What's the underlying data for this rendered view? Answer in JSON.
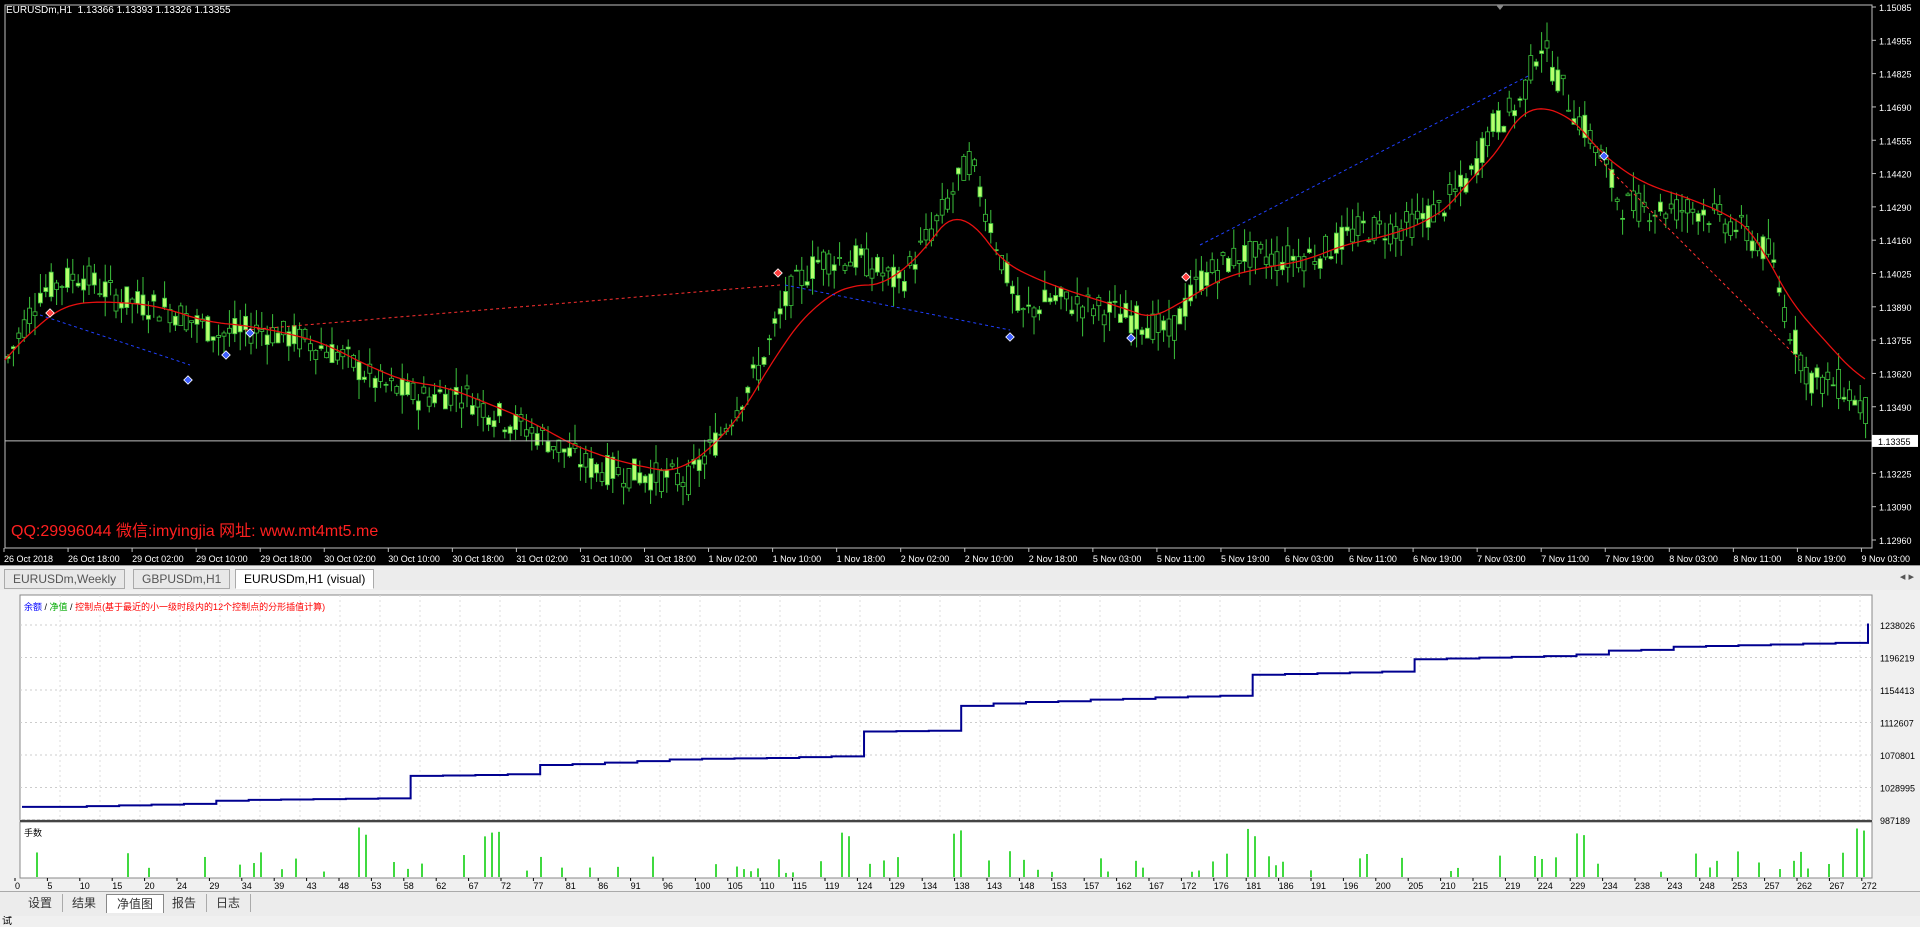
{
  "chart": {
    "symbol_header": "EURUSDm,H1  1.13366 1.13393 1.13326 1.13355",
    "watermark": "QQ:29996044 微信:imyingjia 网址: www.mt4mt5.me",
    "current_price": "1.13355",
    "price_labels": [
      "1.15085",
      "1.14955",
      "1.14825",
      "1.14690",
      "1.14555",
      "1.14420",
      "1.14290",
      "1.14160",
      "1.14025",
      "1.13890",
      "1.13755",
      "1.13620",
      "1.13490",
      "1.13355",
      "1.13225",
      "1.13090",
      "1.12960"
    ],
    "time_labels": [
      "26 Oct 2018",
      "26 Oct 18:00",
      "29 Oct 02:00",
      "29 Oct 10:00",
      "29 Oct 18:00",
      "30 Oct 02:00",
      "30 Oct 10:00",
      "30 Oct 18:00",
      "31 Oct 02:00",
      "31 Oct 10:00",
      "31 Oct 18:00",
      "1 Nov 02:00",
      "1 Nov 10:00",
      "1 Nov 18:00",
      "2 Nov 02:00",
      "2 Nov 10:00",
      "2 Nov 18:00",
      "5 Nov 03:00",
      "5 Nov 11:00",
      "5 Nov 19:00",
      "6 Nov 03:00",
      "6 Nov 11:00",
      "6 Nov 19:00",
      "7 Nov 03:00",
      "7 Nov 11:00",
      "7 Nov 19:00",
      "8 Nov 03:00",
      "8 Nov 11:00",
      "8 Nov 19:00",
      "9 Nov 03:00"
    ],
    "colors": {
      "bull": "#b6ff6e",
      "bear": "#000000",
      "wick": "#3cc43c",
      "ma": "#e81010",
      "zigzag_red": "#ff3030",
      "zigzag_blue": "#2040ff"
    }
  },
  "chart_tabs": [
    {
      "label": "EURUSDm,Weekly",
      "active": false
    },
    {
      "label": "GBPUSDm,H1",
      "active": false
    },
    {
      "label": "EURUSDm,H1 (visual)",
      "active": true
    }
  ],
  "equity": {
    "legend_balance": "余额",
    "legend_sep1": " / ",
    "legend_equity": "净值",
    "legend_sep2": " / ",
    "legend_points": "控制点(基于最近的小一级时段内的12个控制点的分形插值计算)",
    "y_labels": [
      "1238026",
      "1196219",
      "1154413",
      "1112607",
      "1070801",
      "1028995",
      "987189"
    ],
    "lots_label": "手数",
    "x_labels": [
      "0",
      "5",
      "10",
      "15",
      "20",
      "24",
      "29",
      "34",
      "39",
      "43",
      "48",
      "53",
      "58",
      "62",
      "67",
      "72",
      "77",
      "81",
      "86",
      "91",
      "96",
      "100",
      "105",
      "110",
      "115",
      "119",
      "124",
      "129",
      "134",
      "138",
      "143",
      "148",
      "153",
      "157",
      "162",
      "167",
      "172",
      "176",
      "181",
      "186",
      "191",
      "196",
      "200",
      "205",
      "210",
      "215",
      "219",
      "224",
      "229",
      "234",
      "238",
      "243",
      "248",
      "253",
      "257",
      "262",
      "267",
      "272"
    ],
    "balance_values": [
      1004000,
      1004000,
      1005000,
      1006000,
      1007000,
      1008000,
      1012000,
      1013000,
      1013500,
      1014000,
      1014500,
      1015000,
      1044000,
      1044500,
      1045000,
      1046000,
      1058000,
      1059000,
      1061000,
      1063000,
      1065000,
      1066000,
      1066500,
      1067000,
      1068000,
      1069000,
      1101000,
      1101500,
      1102000,
      1134000,
      1137000,
      1139000,
      1140000,
      1142000,
      1143000,
      1145000,
      1146000,
      1147000,
      1174000,
      1175000,
      1176000,
      1177000,
      1178000,
      1194000,
      1195000,
      1196000,
      1197000,
      1198000,
      1200000,
      1205000,
      1206000,
      1210000,
      1211000,
      1212000,
      1213000,
      1214000,
      1215000,
      1240000
    ],
    "colors": {
      "balance": "#000090",
      "legend_balance": "#0000ff",
      "legend_equity": "#00aa00",
      "legend_points": "#ff0000",
      "lots": "#00cc00"
    }
  },
  "bottom_tabs": [
    {
      "label": "设置",
      "active": false
    },
    {
      "label": "结果",
      "active": false
    },
    {
      "label": "净值图",
      "active": true
    },
    {
      "label": "报告",
      "active": false
    },
    {
      "label": "日志",
      "active": false
    }
  ],
  "side_label": "测试"
}
